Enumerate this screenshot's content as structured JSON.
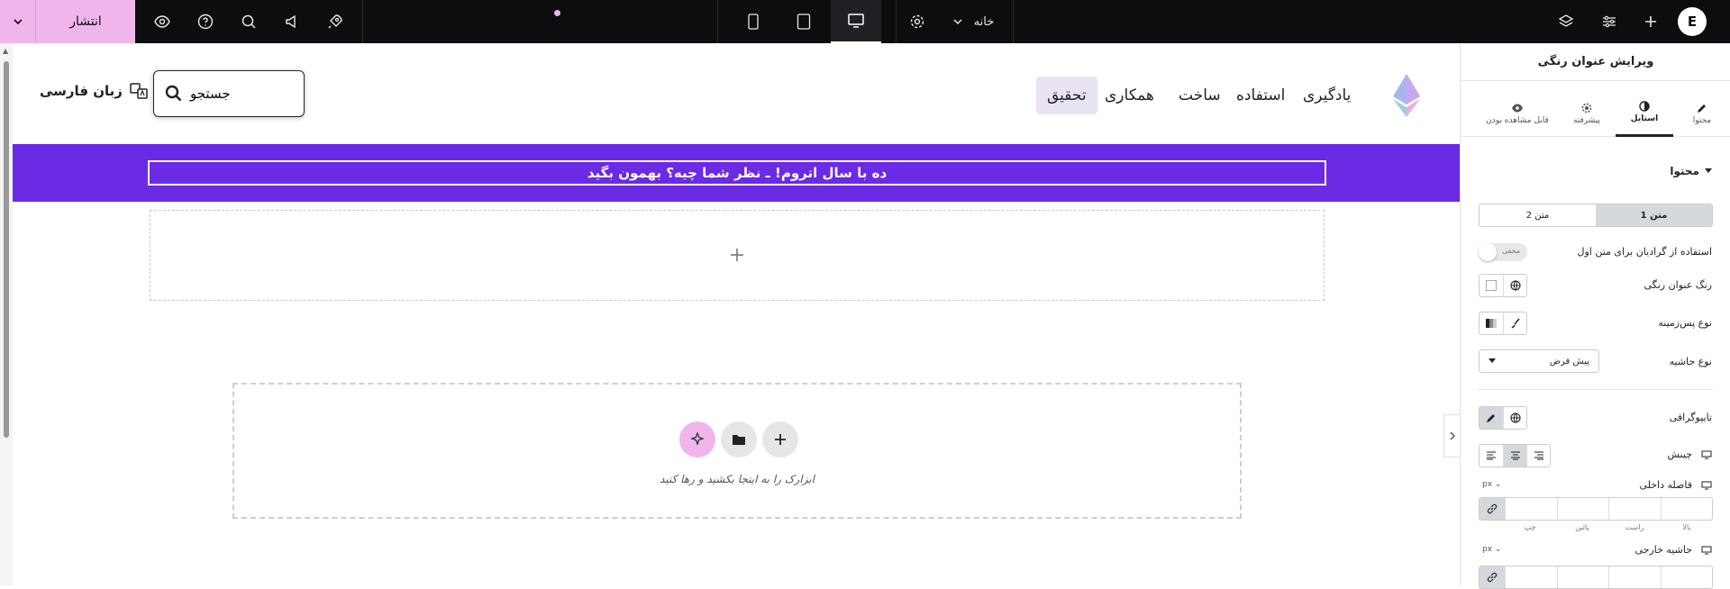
{
  "topbar": {
    "publish_label": "انتشار",
    "page_label": "خانه",
    "logo": "E"
  },
  "site": {
    "nav": [
      "یادگیری",
      "استفاده",
      "ساخت",
      "همکاری",
      "تحقیق"
    ],
    "search_text": "جستجو",
    "language": "زبان فارسی"
  },
  "banner_text": "ده با سال اتروم! ـ نظر شما چیه؟ بهمون بگید",
  "empty_section_plus": "+",
  "drop_text": "ابزارک را به اینجا بکشید و رها کنید",
  "panel": {
    "title": "ویرایش عنوان رنگی",
    "tabs": [
      "محتوا",
      "استایل",
      "پیشرفته",
      "قابل مشاهده بودن"
    ],
    "section": "محتوا",
    "seg": [
      "متن 1",
      "متن 2"
    ],
    "gradient_label": "استفاده از گرادیان برای متن اول",
    "toggle_text": "مخفی",
    "color_label": "رنگ عنوان رنگی",
    "bg_type_label": "نوع پس‌زمینه",
    "border_type_label": "نوع حاشیه",
    "border_select": "پیش فرض",
    "typography_label": "تایپوگرافی",
    "align_label": "چینش",
    "padding_label": "فاصله داخلی",
    "margin_label": "حاشیه خارجی",
    "unit": "px",
    "dims": [
      "بالا",
      "راست",
      "پائین",
      "چپ"
    ]
  },
  "colors": {
    "accent": "#6b2ae3",
    "publish": "#f0b6ec",
    "topbar": "#0c0d0e"
  }
}
